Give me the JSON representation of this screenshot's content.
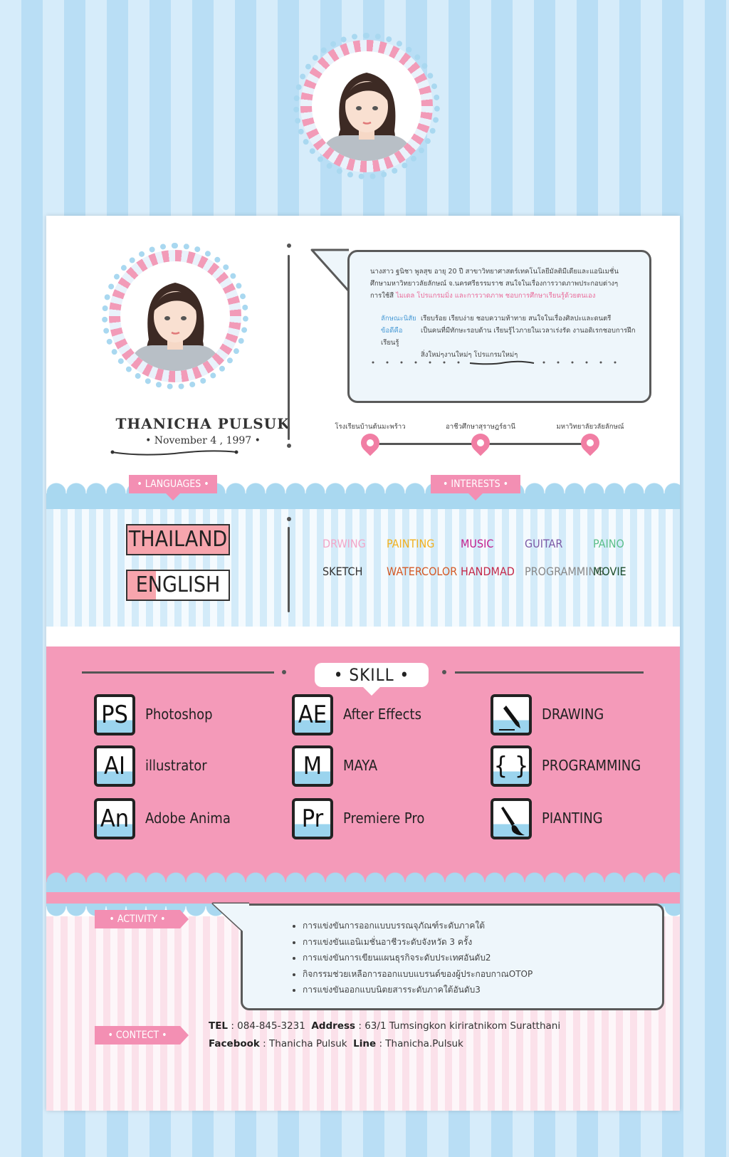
{
  "profile": {
    "name": "THANICHA PULSUK",
    "dob": "• November 4 , 1997 •"
  },
  "about": {
    "line1": "นางสาว ฐนิชา พูลสุข อายุ 20 ปี สาขาวิทยาศาสตร์เทคโนโลยีมัลติมีเดียและแอนิเมชั่น",
    "line2": "ศึกษามหาวิทยาวลัยลักษณ์ จ.นครศรีธรรมราช สนใจในเรื่องการวาดภาพประกอบต่างๆ",
    "line3_prefix": "การใช้สี ",
    "line3_highlight": "ไมเดล โปรแกรมมิ่ง และการวาดภาพ ชอบการศึกษาเรียนรู้ด้วยตนเอง",
    "trait_label": "ลักษณะนิสัย",
    "trait_text": "เรียบร้อย เรียบง่าย ชอบความท้าทาย สนใจในเรื่องศิลปะและดนตรี",
    "strength_label": "ข้อดีคือ",
    "strength_text": "เป็นคนที่มีทักษะรอบด้าน เรียนรู้ไวภายในเวลาเร่งรัด งานอดิเรกชอบการฝึกเรียนรู้",
    "strength_text2": "สิ่งใหม่ๆงานใหม่ๆ โปรแกรมใหม่ๆ"
  },
  "education": [
    {
      "label": "โรงเรียนบ้านต้นมะพร้าว"
    },
    {
      "label": "อาชีวศึกษาสุราษฎร์ธานี"
    },
    {
      "label": "มหาวิทยาลัยวลัยลักษณ์"
    }
  ],
  "languages": {
    "title": "• LANGUAGES •",
    "items": [
      {
        "label": "THAILAND",
        "level": 1.0
      },
      {
        "label": "ENGLISH",
        "level": 0.28
      }
    ]
  },
  "interests": {
    "title": "• INTERESTS •",
    "items": [
      {
        "label": "DRWING",
        "color": "#f3a6c8"
      },
      {
        "label": "PAINTING",
        "color": "#f2b01e"
      },
      {
        "label": "MUSIC",
        "color": "#c21e8c"
      },
      {
        "label": "GUITAR",
        "color": "#7b5aa6"
      },
      {
        "label": "PAINO",
        "color": "#5cbf8a"
      },
      {
        "label": "SKETCH",
        "color": "#333333"
      },
      {
        "label": "WATERCOLOR",
        "color": "#d45a26"
      },
      {
        "label": "HANDMAD",
        "color": "#c42a4a"
      },
      {
        "label": "PROGRAMMING",
        "color": "#888888"
      },
      {
        "label": "MOVIE",
        "color": "#1d4d2b"
      }
    ]
  },
  "skills": {
    "title": "• SKILL •",
    "items": [
      {
        "icon": "PS",
        "label": "Photoshop",
        "level": 0.35
      },
      {
        "icon": "AI",
        "label": "illustrator",
        "level": 0.35
      },
      {
        "icon": "An",
        "label": "Adobe Anima",
        "level": 0.35
      },
      {
        "icon": "AE",
        "label": "After Effects",
        "level": 0.35
      },
      {
        "icon": "M",
        "label": "MAYA",
        "level": 0.35
      },
      {
        "icon": "Pr",
        "label": "Premiere Pro",
        "level": 0.35
      },
      {
        "icon": "pen-icon",
        "label": "DRAWING",
        "level": 0.35
      },
      {
        "icon": "{ }",
        "label": "PROGRAMMING",
        "level": 0.35
      },
      {
        "icon": "brush-icon",
        "label": "PIANTING",
        "level": 0.35
      }
    ]
  },
  "activity": {
    "title": "• ACTIVITY •",
    "items": [
      "การแข่งขันการออกแบบบรรณจุภัณฑ์ระดับภาคใต้",
      "การแข่งขันแอนิเมชั่นอาชีวระดับจังหวัด 3 ครั้ง",
      "การแข่งขันการเขียนแผนธุรกิจระดับประเทศอันดับ2",
      "กิจกรรมช่วยเหลือการออกแบบแบรนด์ของผู้ประกอบกาณOTOP",
      "การแข่งขันออกแบบนิตยสารระดับภาคใต้อันดับ3"
    ]
  },
  "contact": {
    "title": "• CONTECT •",
    "tel_label": "TEL",
    "tel": " : 084-845-3231",
    "address_label": "Address",
    "address": ": 63/1 Tumsingkon kiriratnikom Suratthani",
    "facebook_label": "Facebook",
    "facebook": " : Thanicha Pulsuk",
    "line_label": "Line",
    "line": ": Thanicha.Pulsuk"
  },
  "colors": {
    "pink": "#f49ab9",
    "blue": "#a9d8f0",
    "dark": "#333333"
  }
}
